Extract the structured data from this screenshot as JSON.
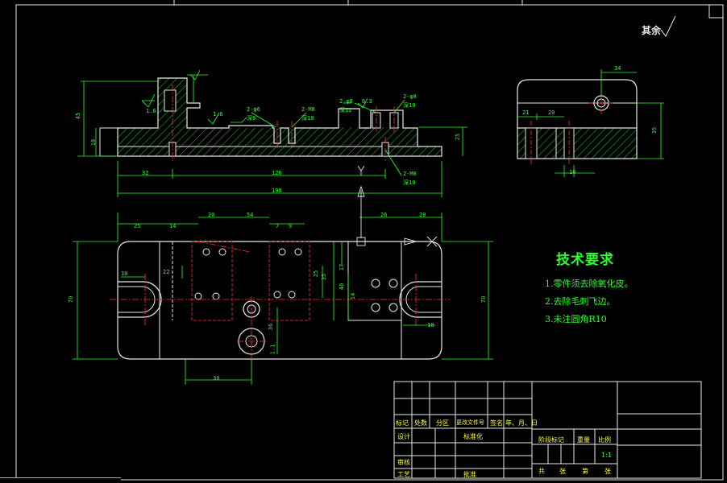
{
  "notes": {
    "title": "技术要求",
    "items": [
      "1.零件须去除氧化皮。",
      "2.去除毛刺飞边。",
      "3.未注圆角R10"
    ]
  },
  "roughness": "其余",
  "title_block": {
    "hdr": [
      "标记",
      "处数",
      "分区",
      "更改文件号",
      "签名",
      "年、月、日"
    ],
    "design": "设计",
    "standard": "标准化",
    "review": "审核",
    "process": "工艺",
    "approve": "批准",
    "stage": "阶段标记",
    "weight": "重量",
    "scale": "比例",
    "scale_val": "1:1",
    "sheets": [
      "共",
      "张",
      "第",
      "张"
    ]
  },
  "dims": {
    "top_view": [
      "45",
      "18",
      "2-φ6",
      "深8",
      "2-M8",
      "深10",
      "2-φ8",
      "深12",
      "2-φ8",
      "深10",
      "2-M8",
      "深10",
      "32",
      "126",
      "190",
      "25",
      "1.6",
      "1.6",
      "6.3"
    ],
    "side_view": [
      "34",
      "21",
      "20",
      "35",
      "10"
    ],
    "plan_view": [
      "25",
      "14",
      "20",
      "54",
      "7",
      "9",
      "26",
      "20",
      "22",
      "25",
      "70",
      "70",
      "10",
      "10",
      "40",
      "14",
      "17",
      "35",
      "36",
      "30",
      "1.1"
    ]
  },
  "colors": {
    "outline": "#ffffff",
    "dim": "#2cff2c",
    "center": "#ff3030",
    "hatch": "#2cff2c",
    "title": "#2cff2c"
  }
}
